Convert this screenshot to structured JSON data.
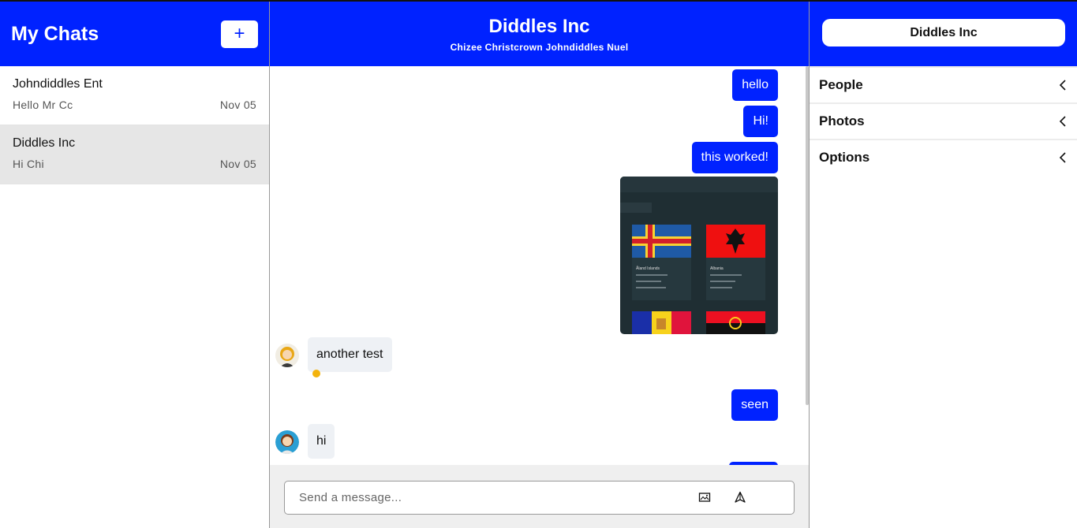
{
  "sidebar": {
    "title": "My Chats",
    "new_chat_label": "+",
    "chats": [
      {
        "name": "Johndiddles Ent",
        "last_message": "Hello Mr Cc",
        "date": "Nov 05"
      },
      {
        "name": "Diddles Inc",
        "last_message": "Hi Chi",
        "date": "Nov 05"
      }
    ]
  },
  "conversation": {
    "title": "Diddles Inc",
    "members": "Chizee Christcrown Johndiddles Nuel",
    "messages": [
      {
        "direction": "out",
        "text": "hello"
      },
      {
        "direction": "out",
        "text": "Hi!"
      },
      {
        "direction": "out",
        "text": "this worked!"
      },
      {
        "direction": "out",
        "type": "image",
        "flags": [
          "Åland Islands",
          "Albania"
        ]
      },
      {
        "direction": "in",
        "text": "another test"
      },
      {
        "direction": "out",
        "text": "seen"
      },
      {
        "direction": "in",
        "text": "hi"
      }
    ],
    "composer": {
      "placeholder": "Send a message..."
    }
  },
  "details": {
    "title": "Diddles Inc",
    "sections": [
      "People",
      "Photos",
      "Options"
    ]
  },
  "colors": {
    "accent": "#0022ff",
    "bubble_in": "#eef1f5",
    "active_chat": "#e6e6e6"
  }
}
